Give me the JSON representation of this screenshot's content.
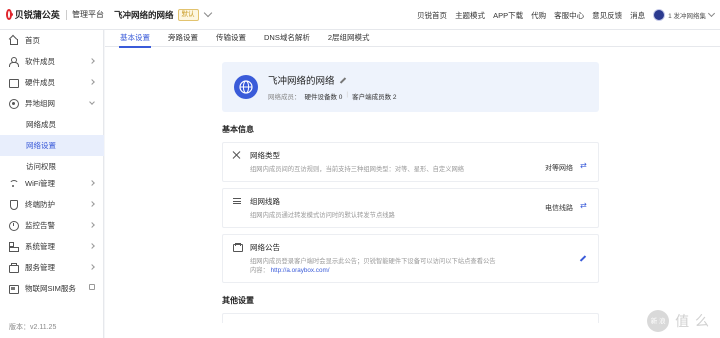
{
  "header": {
    "brand_name": "贝锐蒲公英",
    "brand_sub": "管理平台",
    "network_name": "飞冲网络的网络",
    "network_badge": "默认",
    "nav": [
      "贝锐首页",
      "主题模式",
      "APP下载",
      "代购",
      "客服中心",
      "意见反馈",
      "消息"
    ],
    "user_name": "1 发冲网络集"
  },
  "sidebar": {
    "items": [
      {
        "label": "首页",
        "icon": "home-icon"
      },
      {
        "label": "软件成员",
        "icon": "user-icon"
      },
      {
        "label": "硬件成员",
        "icon": "device-icon"
      },
      {
        "label": "异地组网",
        "icon": "network-icon"
      },
      {
        "label": "WiFi管理",
        "icon": "wifi-icon"
      },
      {
        "label": "终端防护",
        "icon": "shield-icon"
      },
      {
        "label": "监控告警",
        "icon": "monitor-icon"
      },
      {
        "label": "系统管理",
        "icon": "grid-icon"
      },
      {
        "label": "服务管理",
        "icon": "briefcase-icon"
      },
      {
        "label": "物联网SIM服务",
        "icon": "sim-icon"
      }
    ],
    "sub_items": [
      "网络成员",
      "网络设置",
      "访问权限"
    ],
    "active_sub": "网络设置",
    "version": "版本：v2.11.25"
  },
  "tabs": [
    "基本设置",
    "旁路设置",
    "传输设置",
    "DNS域名解析",
    "2层组网模式"
  ],
  "network_card": {
    "name": "飞冲网络的网络",
    "members_label": "网络成员：",
    "hardware_label": "硬件设备数 0",
    "client_label": "客户端成员数 2"
  },
  "basic_info": {
    "title": "基本信息",
    "settings": [
      {
        "name": "网络类型",
        "desc": "组网内成员间的互访规则，当前支持三种组网类型：对等、星形、自定义网络",
        "value": "对等网络"
      },
      {
        "name": "组网线路",
        "desc": "组网内成员通过转发模式访问时的默认转发节点线路",
        "value": "电信线路"
      },
      {
        "name": "网络公告",
        "desc": "组网内成员登录客户端时会显示此公告；贝锐智能硬件下设备可以访问以下站点查看公告内容：",
        "link": "http://a.oraybox.com/"
      }
    ]
  },
  "other_settings": {
    "title": "其他设置"
  },
  "watermark": {
    "circle": "新 浪",
    "text": "值 么"
  },
  "colors": {
    "accent": "#3a5bd9",
    "brand_red": "#e0262d",
    "card_bg": "#eef3fc"
  }
}
